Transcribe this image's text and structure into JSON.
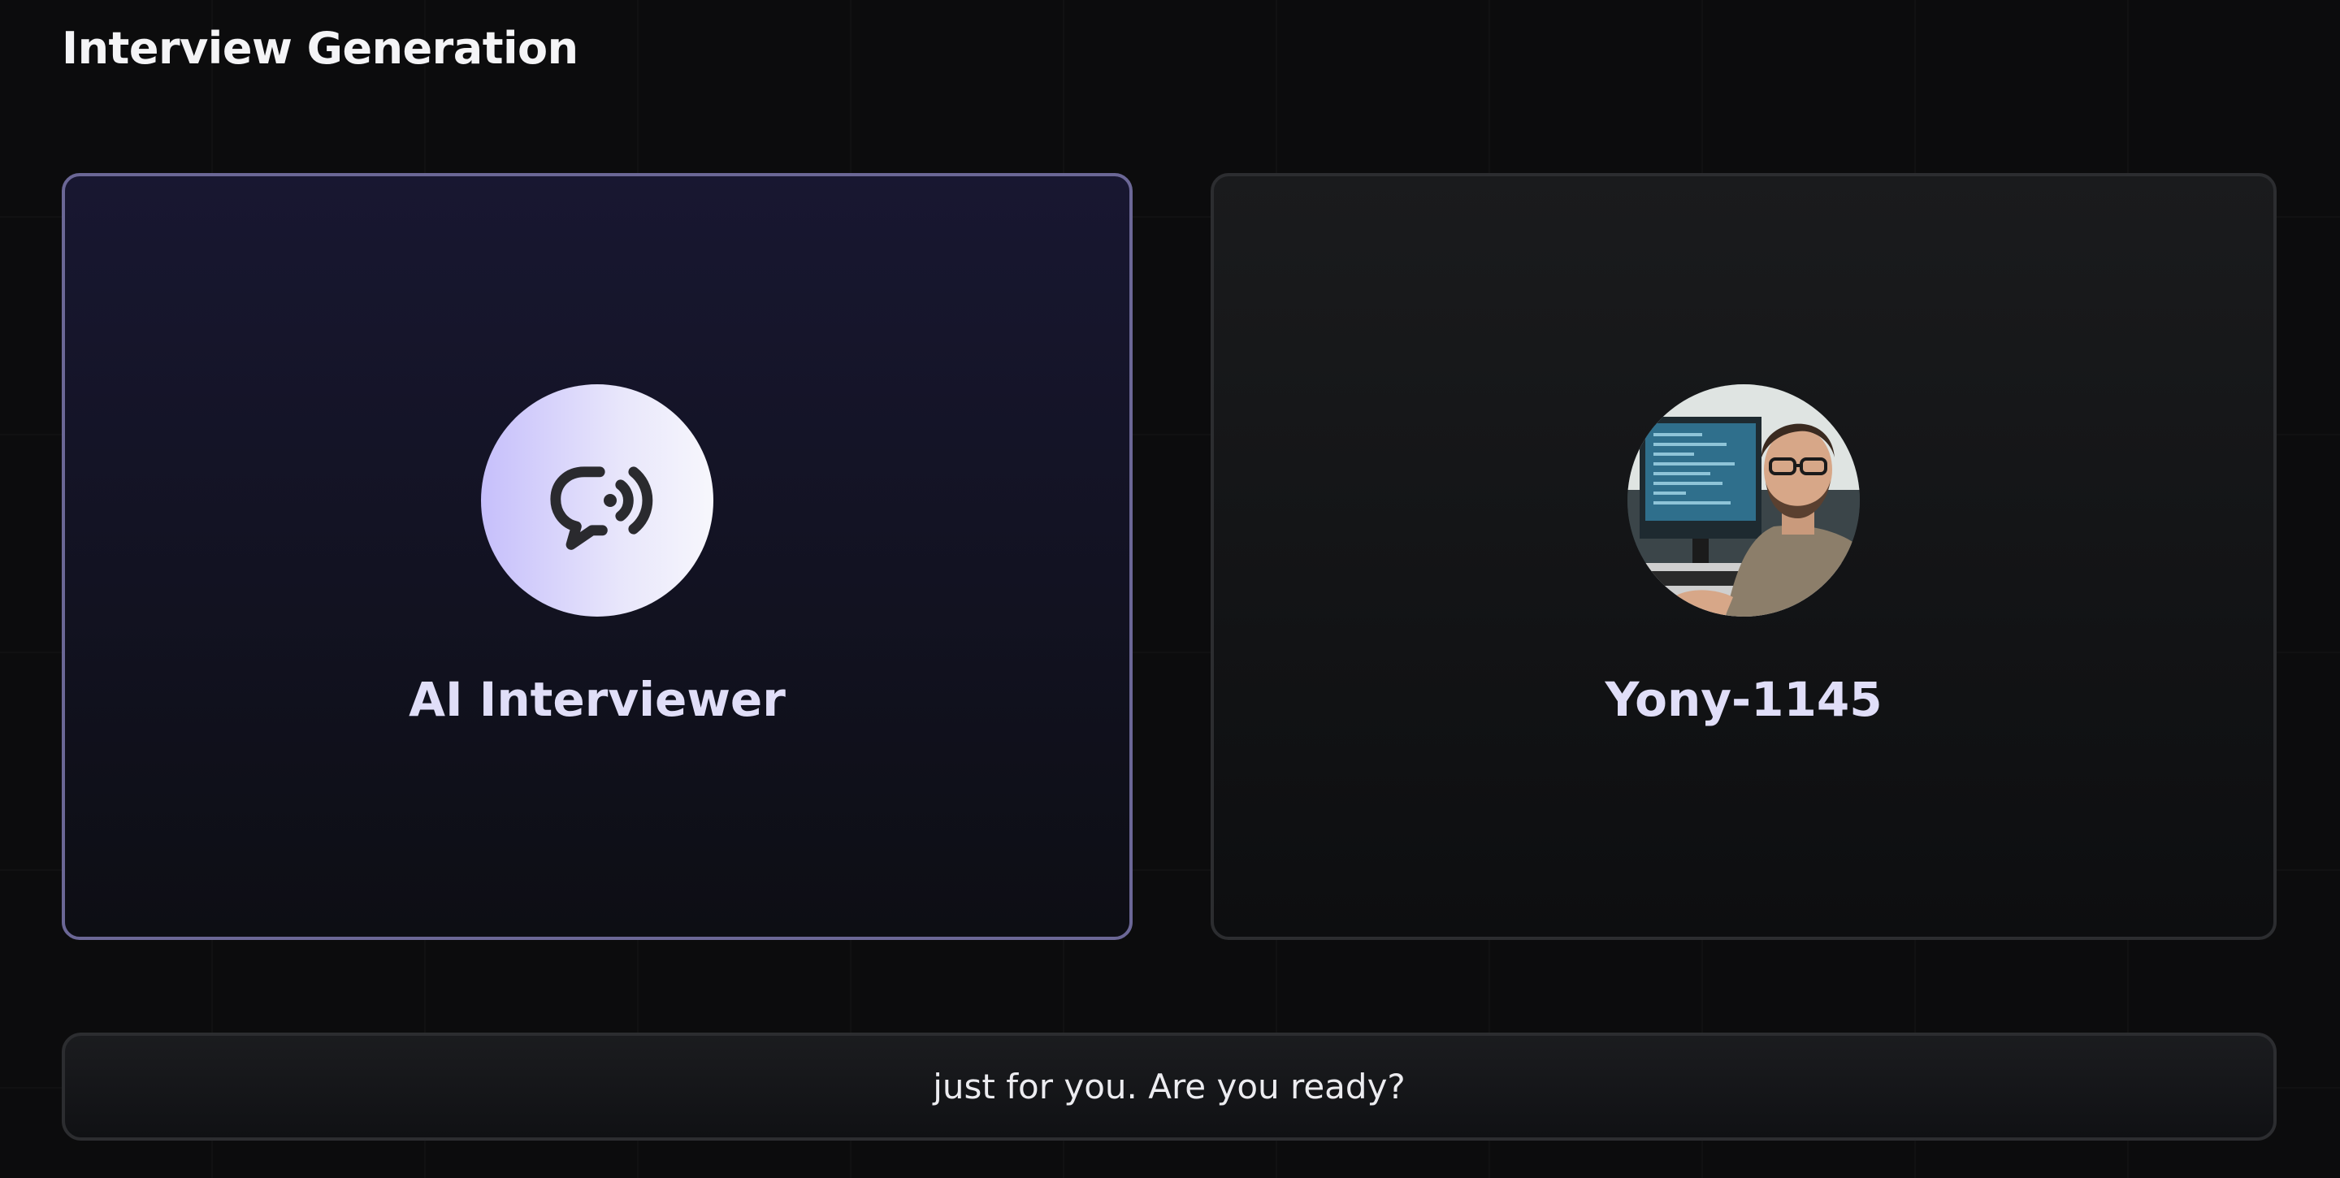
{
  "header": {
    "title": "Interview Generation"
  },
  "ai_card": {
    "label": "AI Interviewer",
    "icon": "chat-sound-icon"
  },
  "user_card": {
    "label": "Yony-1145",
    "avatar": "user-photo-avatar"
  },
  "transcript": {
    "text": "just for you. Are you ready?"
  },
  "colors": {
    "accent_border": "#6b6796",
    "ai_avatar_light": "#f7f7fc",
    "ai_avatar_tint": "#c6bffb",
    "label_text": "#e0def8"
  }
}
